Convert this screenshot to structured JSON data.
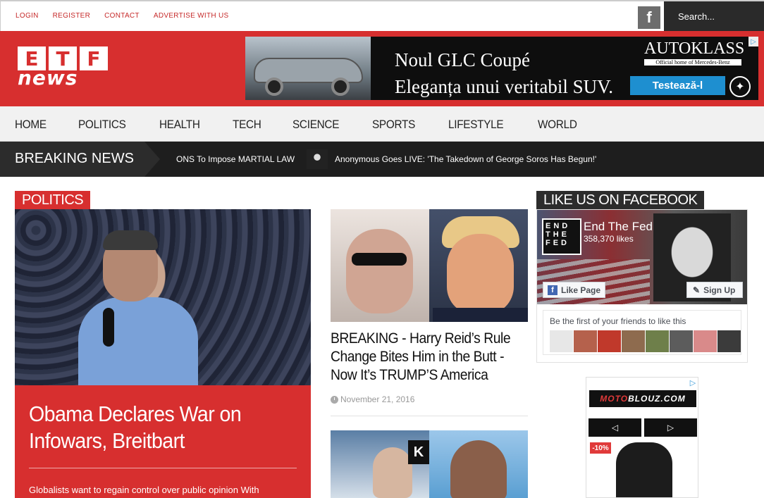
{
  "topbar": {
    "links": [
      "LOGIN",
      "REGISTER",
      "CONTACT",
      "ADVERTISE WITH US"
    ],
    "facebook_icon": "facebook-icon",
    "search_placeholder": "Search..."
  },
  "header": {
    "logo_letters": [
      "E",
      "T",
      "F"
    ],
    "logo_word": "news",
    "ad": {
      "headline_1": "Noul GLC Coupé",
      "headline_2": "Eleganța unui veritabil SUV.",
      "brand": "AUTOKLASS",
      "brand_sub": "Official home of Mercedes-Benz",
      "cta": "Testează-l",
      "colors": {
        "background": "#0e0e0e",
        "cta": "#1e8fd0"
      }
    }
  },
  "nav": {
    "items": [
      "HOME",
      "POLITICS",
      "HEALTH",
      "TECH",
      "SCIENCE",
      "SPORTS",
      "LIFESTYLE",
      "WORLD"
    ]
  },
  "breaking": {
    "label": "BREAKING NEWS",
    "ticker_1": "ONS To Impose MARTIAL LAW",
    "ticker_2": "Anonymous Goes LIVE: 'The Takedown of George Soros Has Begun!'"
  },
  "main": {
    "category": "POLITICS",
    "featured": {
      "title": "Obama Declares War on Infowars, Breitbart",
      "excerpt": "Globalists want to regain control over public opinion With"
    },
    "articles": [
      {
        "title": "BREAKING - Harry Reid’s Rule Change Bites Him in the Butt - Now It’s TRUMP’S America",
        "date": "November 21, 2016"
      }
    ]
  },
  "sidebar": {
    "facebook_title": "LIKE US ON FACEBOOK",
    "page_name": "End The Fed",
    "likes": "358,370 likes",
    "avatar_text": "END THE FED",
    "like_button": "Like Page",
    "signup_button": "Sign Up",
    "friends_text": "Be the first of your friends to like this",
    "ad": {
      "logo_pre": "MOTO",
      "logo_post": "BLOUZ.COM",
      "prev": "◁",
      "next": "▷",
      "badge": "-10%"
    }
  },
  "colors": {
    "brand_red": "#d72f2f",
    "dark": "#1e1e1e",
    "link_red": "#c62a2a"
  }
}
